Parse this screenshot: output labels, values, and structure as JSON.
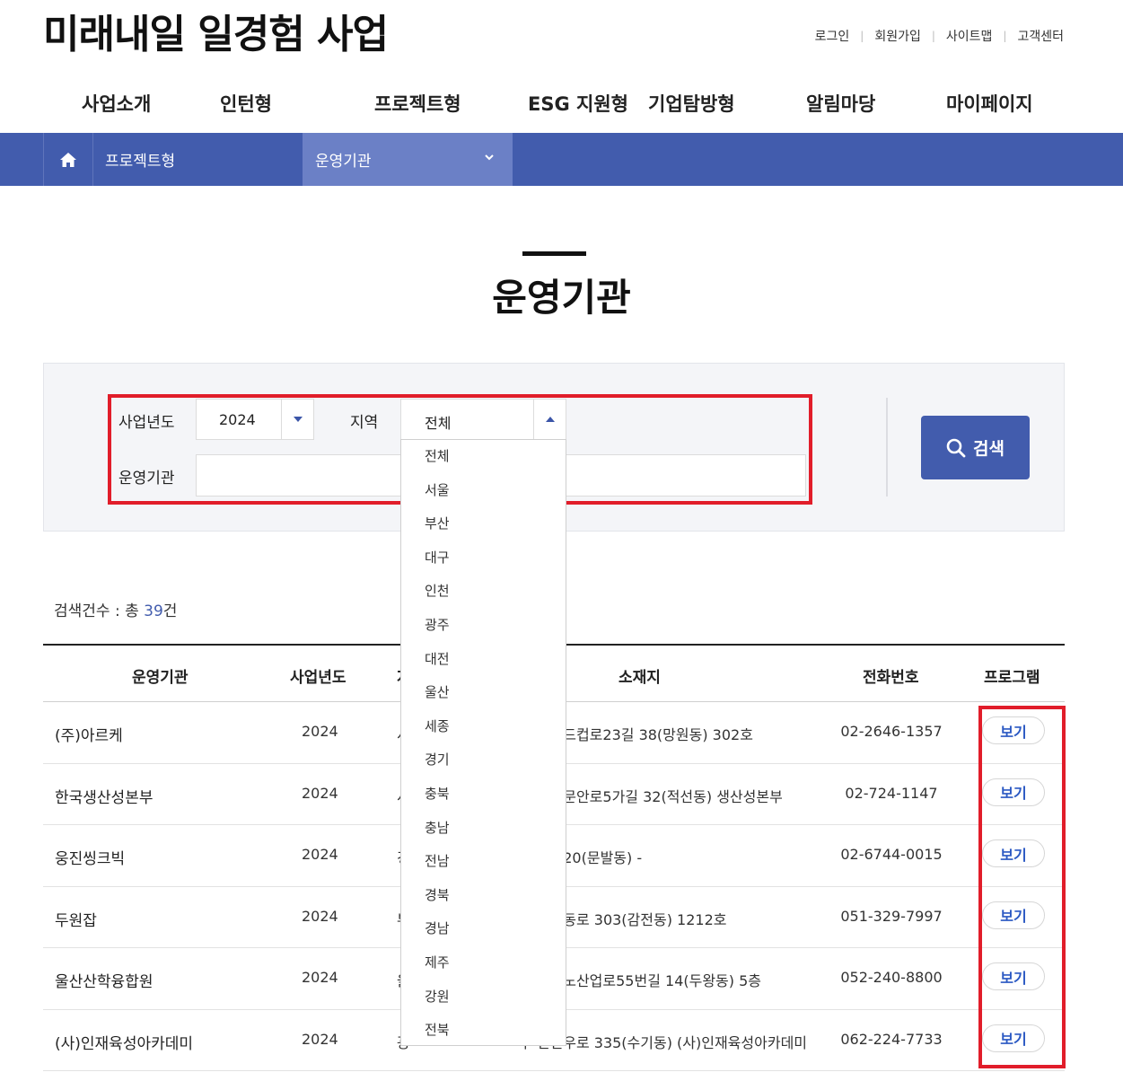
{
  "header": {
    "logo": "미래내일 일경험 사업",
    "util_links": [
      "로그인",
      "회원가입",
      "사이트맵",
      "고객센터"
    ]
  },
  "gnb": [
    "사업소개",
    "인턴형",
    "프로젝트형",
    "ESG 지원형",
    "기업탐방형",
    "알림마당",
    "마이페이지"
  ],
  "subnav": {
    "home_icon": "home-icon",
    "crumb1": "프로젝트형",
    "crumb2": "운영기관"
  },
  "page_title": "운영기관",
  "search": {
    "year_label": "사업년도",
    "year_value": "2024",
    "region_label": "지역",
    "region_value": "전체",
    "org_label": "운영기관",
    "org_value": "",
    "button": "검색",
    "region_options": [
      "전체",
      "서울",
      "부산",
      "대구",
      "인천",
      "광주",
      "대전",
      "울산",
      "세종",
      "경기",
      "충북",
      "충남",
      "전남",
      "경북",
      "경남",
      "제주",
      "강원",
      "전북"
    ]
  },
  "result": {
    "prefix": "검색건수 : 총 ",
    "count": "39",
    "suffix": "건"
  },
  "table": {
    "headers": [
      "운영기관",
      "사업년도",
      "지",
      "소재지",
      "전화번호",
      "프로그램"
    ],
    "view_label": "보기",
    "rows": [
      {
        "org": "(주)아르케",
        "year": "2024",
        "region": "서",
        "addr": "포구 월드컵로23길 38(망원동) 302호",
        "tel": "02-2646-1357"
      },
      {
        "org": "한국생산성본부",
        "year": "2024",
        "region": "서",
        "addr": "로구 새문안로5가길 32(적선동) 생산성본부",
        "tel": "02-724-1147"
      },
      {
        "org": "웅진씽크빅",
        "year": "2024",
        "region": "경",
        "addr": "회동길 20(문발동) -",
        "tel": "02-6744-0015"
      },
      {
        "org": "두원잡",
        "year": "2024",
        "region": "부",
        "addr": "상구 대동로 303(감전동) 1212호",
        "tel": "051-329-7997"
      },
      {
        "org": "울산산학융합원",
        "year": "2024",
        "region": "울",
        "addr": "구 테크노산업로55번길 14(두왕동) 5층",
        "tel": "052-240-8800"
      },
      {
        "org": "(사)인재육성아카데미",
        "year": "2024",
        "region": "광",
        "addr": "구 천변우로 335(수기동) (사)인재육성아카데미",
        "tel": "062-224-7733"
      }
    ]
  }
}
